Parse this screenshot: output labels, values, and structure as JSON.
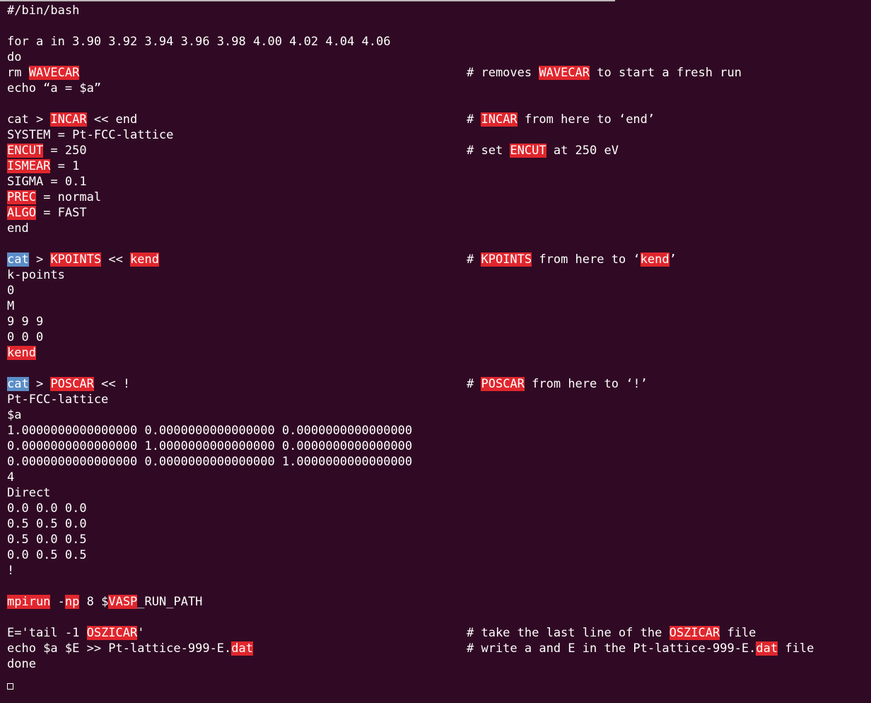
{
  "line01": {
    "t1": "#/bin/bash"
  },
  "line03": {
    "t1": "for a in 3.90 3.92 3.94 3.96 3.98 4.00 4.02 4.04 4.06"
  },
  "line04": {
    "t1": "do"
  },
  "line05": {
    "t1": "rm ",
    "h1": "WAVECAR",
    "c1": "# removes ",
    "ch1": "WAVECAR",
    "c2": " to start a fresh run"
  },
  "line06": {
    "t1": "echo “a = $a”"
  },
  "line08": {
    "t1": "cat > ",
    "h1": "INCAR",
    "t2": " << end",
    "c1": "# ",
    "ch1": "INCAR",
    "c2": " from here to ‘end’"
  },
  "line09": {
    "t1": "SYSTEM = Pt-FCC-lattice"
  },
  "line10": {
    "h1": "ENCUT",
    "t1": " = 250",
    "c1": "# set ",
    "ch1": "ENCUT",
    "c2": " at 250 eV"
  },
  "line11": {
    "h1": "ISMEAR",
    "t1": " = 1"
  },
  "line12": {
    "t1": "SIGMA = 0.1"
  },
  "line13": {
    "h1": "PREC",
    "t1": " = normal"
  },
  "line14": {
    "h1": "ALGO",
    "t1": " = FAST"
  },
  "line15": {
    "t1": "end"
  },
  "line17": {
    "s1": "cat",
    "t1": " > ",
    "h1": "KPOINTS",
    "t2": " << ",
    "h2": "kend",
    "c1": "# ",
    "ch1": "KPOINTS",
    "c2": " from here to ‘",
    "ch2": "kend",
    "c3": "’"
  },
  "line18": {
    "t1": "k-points"
  },
  "line19": {
    "t1": "0"
  },
  "line20": {
    "t1": "M"
  },
  "line21": {
    "t1": "9 9 9"
  },
  "line22": {
    "t1": "0 0 0"
  },
  "line23": {
    "h1": "kend"
  },
  "line25": {
    "s1": "cat",
    "t1": " > ",
    "h1": "POSCAR",
    "t2": " << !",
    "c1": "# ",
    "ch1": "POSCAR",
    "c2": " from here to ‘!’"
  },
  "line26": {
    "t1": "Pt-FCC-lattice"
  },
  "line27": {
    "t1": "$a"
  },
  "line28": {
    "t1": "1.0000000000000000 0.0000000000000000 0.0000000000000000"
  },
  "line29": {
    "t1": "0.0000000000000000 1.0000000000000000 0.0000000000000000"
  },
  "line30": {
    "t1": "0.0000000000000000 0.0000000000000000 1.0000000000000000"
  },
  "line31": {
    "t1": "4"
  },
  "line32": {
    "t1": "Direct"
  },
  "line33": {
    "t1": "0.0 0.0 0.0"
  },
  "line34": {
    "t1": "0.5 0.5 0.0"
  },
  "line35": {
    "t1": "0.5 0.0 0.5"
  },
  "line36": {
    "t1": "0.0 0.5 0.5"
  },
  "line37": {
    "t1": "!"
  },
  "line39": {
    "h1": "mpirun",
    "t1": " -",
    "h2": "np",
    "t2": " 8 $",
    "h3": "VASP",
    "t3": "_RUN_PATH"
  },
  "line41": {
    "t1": "E='tail -1 ",
    "h1": "OSZICAR",
    "t2": "'",
    "c1": "# take the last line of the ",
    "ch1": "OSZICAR",
    "c2": " file"
  },
  "line42": {
    "t1": "echo $a $E >> Pt-lattice-999-E.",
    "h1": "dat",
    "c1": "# write a and E in the Pt-lattice-999-E.",
    "ch1": "dat",
    "c2": " file"
  },
  "line43": {
    "t1": "done"
  },
  "colors": {
    "background": "#300a24",
    "highlight": "#e0262d",
    "selection": "#5b8ec7",
    "text": "#ffffff"
  }
}
